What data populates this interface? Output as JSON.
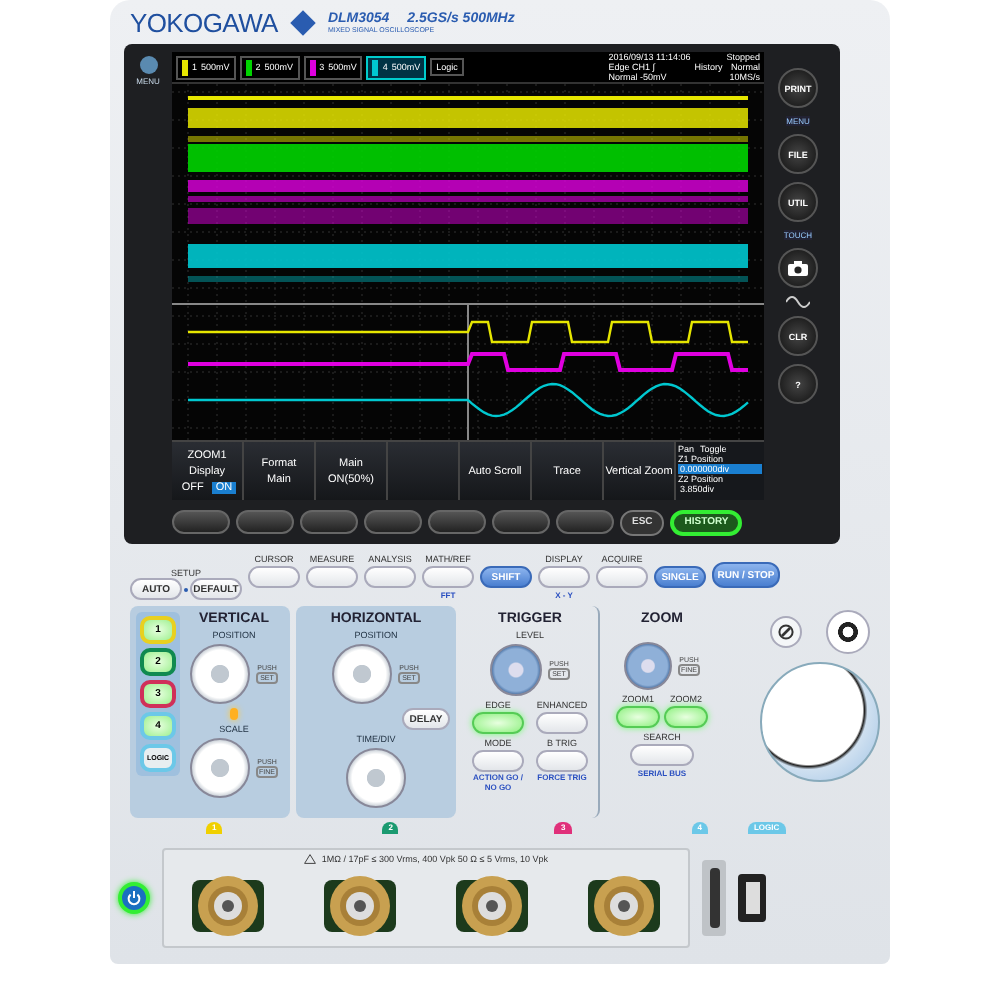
{
  "brand": {
    "name": "YOKOGAWA",
    "model": "DLM3054",
    "spec": "2.5GS/s 500MHz",
    "subtitle": "MIXED SIGNAL OSCILLOSCOPE"
  },
  "screen": {
    "menu_label": "MENU",
    "channels": [
      {
        "label": "1",
        "scale": "500mV",
        "color": "#e6e600",
        "selected": false
      },
      {
        "label": "2",
        "scale": "500mV",
        "color": "#00d400",
        "selected": false
      },
      {
        "label": "3",
        "scale": "500mV",
        "color": "#e000e0",
        "selected": false
      },
      {
        "label": "4",
        "scale": "500mV",
        "color": "#00c8d0",
        "selected": true
      }
    ],
    "logic": "Logic",
    "info": [
      "2016/09/13 11:14:06",
      "Edge CH1 ∫",
      "Normal -50mV"
    ],
    "history": "History",
    "mode": "Normal",
    "status": "Stopped",
    "rate": "10MS/s",
    "menu_title": "ZOOM1",
    "menu": [
      {
        "kind": "toggle",
        "label": "Display",
        "options": [
          {
            "text": "OFF",
            "selected": false
          },
          {
            "text": "ON",
            "selected": true
          }
        ]
      },
      {
        "kind": "value",
        "label": "Format",
        "value": "Main"
      },
      {
        "kind": "value",
        "label": "Main",
        "value": "ON(50%)"
      },
      {
        "kind": "blank"
      },
      {
        "kind": "action",
        "label": "Auto Scroll"
      },
      {
        "kind": "action",
        "label": "Trace"
      },
      {
        "kind": "action",
        "label": "Vertical Zoom"
      }
    ],
    "position_panel": {
      "pan": "Pan",
      "toggle": "Toggle",
      "rows": [
        {
          "label": "Z1 Position",
          "value": "0.000000div",
          "selected": true
        },
        {
          "label": "Z2 Position",
          "value": "3.850div",
          "selected": false
        }
      ]
    }
  },
  "side_buttons": [
    {
      "kind": "round",
      "label": "PRINT"
    },
    {
      "kind": "tag",
      "label": "MENU"
    },
    {
      "kind": "round",
      "label": "FILE"
    },
    {
      "kind": "round",
      "label": "UTIL"
    },
    {
      "kind": "tag",
      "label": "TOUCH"
    },
    {
      "kind": "camera"
    },
    {
      "kind": "wave"
    },
    {
      "kind": "round",
      "label": "CLR"
    },
    {
      "kind": "round",
      "label": "?"
    }
  ],
  "bezel_buttons": [
    {
      "label": "ESC",
      "lit": false
    },
    {
      "label": "HISTORY",
      "lit": true
    }
  ],
  "top_buttons": [
    {
      "kind": "group",
      "caption": "SETUP",
      "buttons": [
        "AUTO",
        "DEFAULT"
      ]
    },
    {
      "kind": "captioned",
      "caption": "CURSOR"
    },
    {
      "kind": "captioned",
      "caption": "MEASURE"
    },
    {
      "kind": "captioned",
      "caption": "ANALYSIS"
    },
    {
      "kind": "captioned",
      "caption": "MATH/REF",
      "sub": "FFT"
    },
    {
      "kind": "blue",
      "label": "SHIFT"
    },
    {
      "kind": "captioned",
      "caption": "DISPLAY",
      "sub": "X - Y"
    },
    {
      "kind": "captioned",
      "caption": "ACQUIRE"
    },
    {
      "kind": "blue",
      "label": "SINGLE"
    },
    {
      "kind": "blue",
      "label": "RUN / STOP"
    }
  ],
  "vertical": {
    "title": "VERTICAL",
    "channel_buttons": [
      {
        "label": "1",
        "color": "#e8d020",
        "lit": true
      },
      {
        "label": "2",
        "color": "#108a50",
        "lit": true
      },
      {
        "label": "3",
        "color": "#d0305a",
        "lit": true
      },
      {
        "label": "4",
        "color": "#6cc8e8",
        "lit": true
      },
      {
        "label": "LOGIC",
        "color": "#6cc8e8",
        "lit": false
      }
    ],
    "knobs": [
      {
        "label": "POSITION",
        "push": "PUSH",
        "push_sub": "SET"
      },
      {
        "label": "SCALE",
        "push": "PUSH",
        "push_sub": "FINE"
      }
    ],
    "led_lit": true
  },
  "horizontal": {
    "title": "HORIZONTAL",
    "knobs": [
      {
        "label": "POSITION",
        "push": "PUSH",
        "push_sub": "SET"
      },
      {
        "label": "TIME/DIV"
      }
    ],
    "delay": "DELAY"
  },
  "trigger": {
    "title": "TRIGGER",
    "knob": {
      "label": "LEVEL",
      "push": "PUSH",
      "push_sub": "SET"
    },
    "buttons": [
      {
        "caption": "EDGE",
        "lit": true
      },
      {
        "caption": "ENHANCED",
        "lit": false
      },
      {
        "caption": "MODE",
        "sub": "ACTION GO / NO GO",
        "lit": false
      },
      {
        "caption": "B TRIG",
        "sub": "FORCE TRIG",
        "lit": false
      }
    ]
  },
  "zoom": {
    "title": "ZOOM",
    "knob": {
      "push": "PUSH",
      "push_sub": "FINE"
    },
    "buttons": [
      {
        "caption": "ZOOM1",
        "lit": true
      },
      {
        "caption": "ZOOM2",
        "lit": true
      },
      {
        "caption": "SEARCH",
        "sub": "SERIAL BUS",
        "lit": false
      }
    ]
  },
  "tabs": [
    {
      "label": "1",
      "color": "#f0d000"
    },
    {
      "label": "2",
      "color": "#1a9a70"
    },
    {
      "label": "3",
      "color": "#e0307a"
    },
    {
      "label": "4",
      "color": "#6cc8e8"
    },
    {
      "label": "LOGIC",
      "color": "#6cc8e8"
    }
  ],
  "inputs": {
    "power_on": true,
    "warning": "1MΩ / 17pF ≤ 300 Vrms, 400 Vpk   50 Ω ≤ 5 Vrms, 10 Vpk"
  }
}
